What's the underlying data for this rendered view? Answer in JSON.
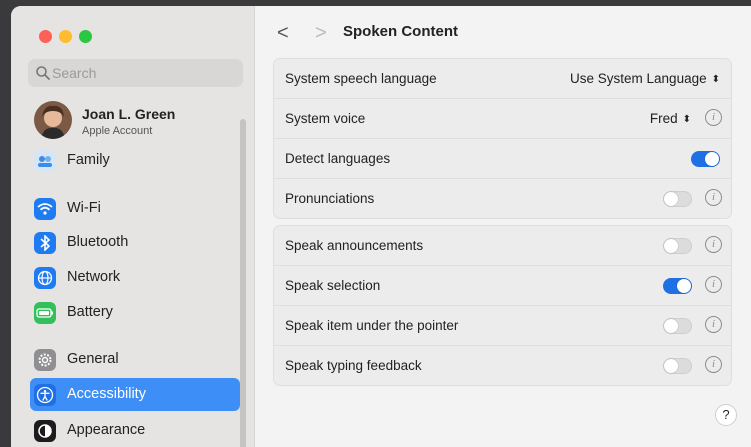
{
  "sidebar": {
    "search_placeholder": "Search",
    "account": {
      "name": "Joan L. Green",
      "subtitle": "Apple Account"
    },
    "items": [
      {
        "label": "Family",
        "icon": "family-icon"
      },
      {
        "label": "Wi-Fi",
        "icon": "wifi-icon"
      },
      {
        "label": "Bluetooth",
        "icon": "bluetooth-icon"
      },
      {
        "label": "Network",
        "icon": "network-icon"
      },
      {
        "label": "Battery",
        "icon": "battery-icon"
      },
      {
        "label": "General",
        "icon": "gear-icon"
      },
      {
        "label": "Accessibility",
        "icon": "accessibility-icon",
        "selected": true
      },
      {
        "label": "Appearance",
        "icon": "appearance-icon"
      }
    ]
  },
  "header": {
    "title": "Spoken Content",
    "back": "<",
    "forward": ">"
  },
  "group1": {
    "language_label": "System speech language",
    "language_value": "Use System Language",
    "voice_label": "System voice",
    "voice_value": "Fred",
    "detect_label": "Detect languages",
    "detect_on": true,
    "pron_label": "Pronunciations",
    "pron_on": false
  },
  "group2": {
    "announce_label": "Speak announcements",
    "announce_on": false,
    "selection_label": "Speak selection",
    "selection_on": true,
    "pointer_label": "Speak item under the pointer",
    "pointer_on": false,
    "typing_label": "Speak typing feedback",
    "typing_on": false
  },
  "help_label": "?",
  "colors": {
    "accent": "#1f6fe5",
    "selected_row": "#3e8ef7"
  }
}
